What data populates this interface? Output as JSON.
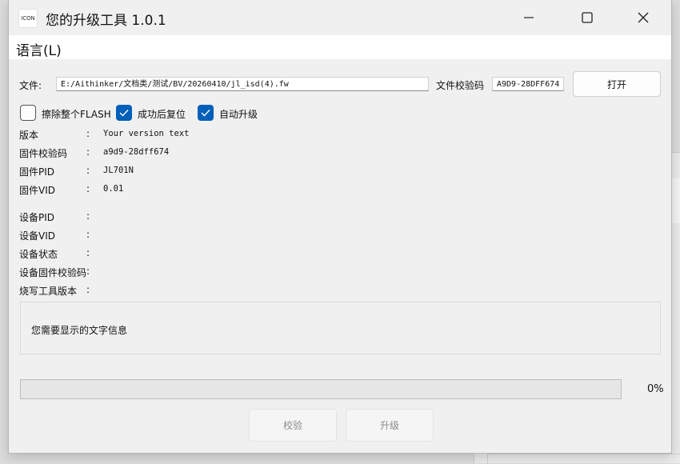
{
  "window": {
    "title": "您的升级工具 1.0.1",
    "icon_text": "ICON"
  },
  "menu": {
    "language": "语言(L)"
  },
  "file_row": {
    "file_label": "文件:",
    "file_path": "E:/Aithinker/文档类/测试/BV/20260410/jl_isd(4).fw",
    "checksum_label": "文件校验码",
    "checksum_value": "A9D9-28DFF674",
    "open_button": "打开"
  },
  "options": [
    {
      "label": "擦除整个FLASH",
      "checked": false
    },
    {
      "label": "成功后复位",
      "checked": true
    },
    {
      "label": "自动升级",
      "checked": true
    }
  ],
  "firmware_info": [
    {
      "label": "版本",
      "value": "Your version text"
    },
    {
      "label": "固件校验码",
      "value": "a9d9-28dff674"
    },
    {
      "label": "固件PID",
      "value": "JL701N"
    },
    {
      "label": "固件VID",
      "value": "0.01"
    }
  ],
  "device_info": [
    {
      "label": "设备PID",
      "value": ""
    },
    {
      "label": "设备VID",
      "value": ""
    },
    {
      "label": "设备状态",
      "value": ""
    },
    {
      "label": "设备固件校验码",
      "value": ""
    },
    {
      "label": "烧写工具版本",
      "value": ""
    }
  ],
  "separator": ":",
  "message": "您需要显示的文字信息",
  "progress": {
    "value": 0,
    "text": "0%"
  },
  "actions": {
    "verify": "校验",
    "upgrade": "升级"
  },
  "colors": {
    "accent": "#005fb8",
    "window_bg": "#f0f0f0",
    "progress_fill": "#06b025"
  },
  "icons": {
    "minimize": "minimize-icon",
    "maximize": "maximize-icon",
    "close": "close-icon",
    "check": "checkmark-icon"
  }
}
